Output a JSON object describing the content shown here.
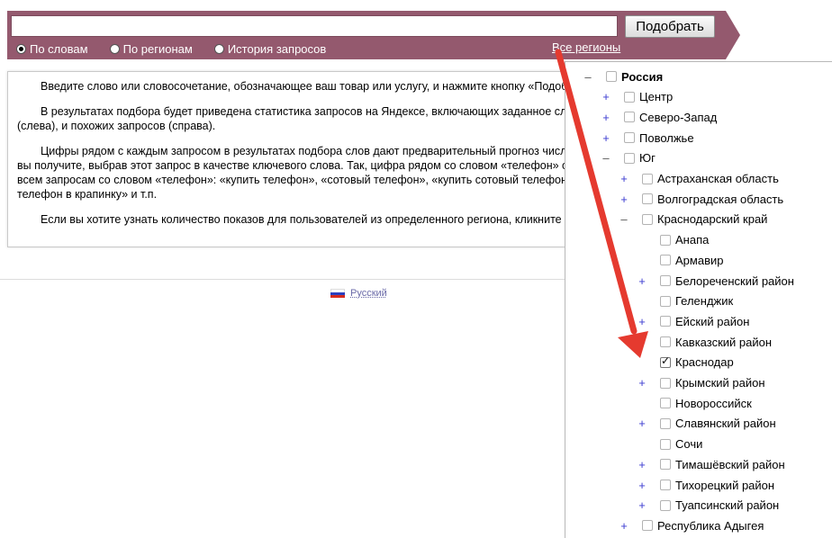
{
  "search": {
    "value": "",
    "placeholder": "",
    "button_label": "Подобрать",
    "modes": [
      {
        "label": "По словам",
        "checked": true
      },
      {
        "label": "По регионам",
        "checked": false
      },
      {
        "label": "История запросов",
        "checked": false
      }
    ],
    "regions_link": "Все регионы"
  },
  "description": {
    "p1": "Введите слово или словосочетание, обозначающее ваш товар или услугу, и нажмите кнопку «Подобрать».",
    "p2a": "В результатах подбора будет приведена статистика запросов на Яндексе, включающих заданное слово",
    "p2b": "(слева), и похожих запросов (справа).",
    "p3a": "Цифры рядом с каждым запросом в результатах подбора слов дают предварительный прогноз числа показов, которое",
    "p3b": "вы получите, выбрав этот запрос в качестве ключевого слова. Так, цифра рядом со словом «телефон» относится ко",
    "p3c": "всем запросам со словом «телефон»: «купить телефон», «сотовый телефон», «купить сотовый телефон», «купить",
    "p3d": "телефон в крапинку» и т.п.",
    "p4": "Если вы хотите узнать количество показов для пользователей из определенного региона, кликните на ссылку «Все регионы»."
  },
  "footer": {
    "language": "Русский",
    "flag_colors": [
      "#ffffff",
      "#2b3fbf",
      "#d52b1e"
    ]
  },
  "regions_tree": [
    {
      "label": "Россия",
      "toggle": "–",
      "checked": false,
      "bold": true
    },
    {
      "label": "Центр",
      "toggle": "+",
      "checked": false
    },
    {
      "label": "Северо-Запад",
      "toggle": "+",
      "checked": false
    },
    {
      "label": "Поволжье",
      "toggle": "+",
      "checked": false
    },
    {
      "label": "Юг",
      "toggle": "–",
      "checked": false
    },
    {
      "label": "Астраханская область",
      "toggle": "+",
      "checked": false
    },
    {
      "label": "Волгоградская область",
      "toggle": "+",
      "checked": false
    },
    {
      "label": "Краснодарский край",
      "toggle": "–",
      "checked": false
    },
    {
      "label": "Анапа",
      "toggle": "",
      "checked": false
    },
    {
      "label": "Армавир",
      "toggle": "",
      "checked": false
    },
    {
      "label": "Белореченский район",
      "toggle": "+",
      "checked": false
    },
    {
      "label": "Геленджик",
      "toggle": "",
      "checked": false
    },
    {
      "label": "Ейский район",
      "toggle": "+",
      "checked": false
    },
    {
      "label": "Кавказский район",
      "toggle": "+",
      "checked": false
    },
    {
      "label": "Краснодар",
      "toggle": "",
      "checked": true
    },
    {
      "label": "Крымский район",
      "toggle": "+",
      "checked": false
    },
    {
      "label": "Новороссийск",
      "toggle": "",
      "checked": false
    },
    {
      "label": "Славянский район",
      "toggle": "+",
      "checked": false
    },
    {
      "label": "Сочи",
      "toggle": "",
      "checked": false
    },
    {
      "label": "Тимашёвский район",
      "toggle": "+",
      "checked": false
    },
    {
      "label": "Тихорецкий район",
      "toggle": "+",
      "checked": false
    },
    {
      "label": "Туапсинский район",
      "toggle": "+",
      "checked": false
    },
    {
      "label": "Республика Адыгея",
      "toggle": "+",
      "checked": false
    }
  ],
  "colors": {
    "bar": "#94596e",
    "arrow": "#e53a2f",
    "plus": "#3a3ad0"
  }
}
